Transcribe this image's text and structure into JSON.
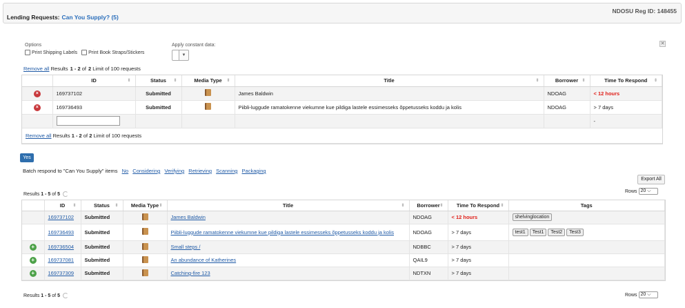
{
  "header": {
    "title": "Lending Requests:",
    "subtitle": "Can You Supply? (5)",
    "reg": "NDOSU Reg ID: 148455"
  },
  "options": {
    "label": "Options",
    "print_shipping": "Print Shipping Labels",
    "print_book": "Print Book Straps/Stickers",
    "apply_label": "Apply constant data:",
    "dropdown_arrow": "▼"
  },
  "close_glyph": "✕",
  "toolbar": {
    "remove_all": "Remove all",
    "results_prefix": "Results",
    "range": "1 - 2",
    "of": "of",
    "total": "2",
    "limit": "Limit of 100 requests"
  },
  "grid1": {
    "columns": [
      "ID",
      "Status",
      "Media Type",
      "Title",
      "Borrower",
      "Time To Respond"
    ],
    "rows": [
      {
        "id": "169737102",
        "status": "Submitted",
        "title": "James Baldwin",
        "borrower": "NDOAG",
        "time": "< 12 hours"
      },
      {
        "id": "169736493",
        "status": "Submitted",
        "title": "Piibli-luggude ramatokenne viekumne kue pildiga lastele essimesseks õppetusseks koddu ja kolis",
        "borrower": "NDOAG",
        "time": "> 7 days"
      }
    ],
    "dash": "-"
  },
  "batch": {
    "yes": "Yes",
    "text": "Batch respond to \"Can You Supply\" items",
    "links": [
      "No",
      "Considering",
      "Verifying",
      "Retrieving",
      "Scanning",
      "Packaging"
    ]
  },
  "export": "Export All",
  "rows_label": "Rows",
  "rows_value": "20",
  "results2": {
    "prefix": "Results",
    "range": "1 - 5",
    "of": "of",
    "total": "5"
  },
  "grid2": {
    "columns": [
      "ID",
      "Status",
      "Media Type",
      "Title",
      "Borrower",
      "Time To Respond",
      "Tags"
    ],
    "rows": [
      {
        "id": "169737102",
        "status": "Submitted",
        "title": "James Baldwin",
        "borrower": "NDOAG",
        "time": "< 12 hours",
        "tags": [
          "shelvinglocation"
        ]
      },
      {
        "id": "169736493",
        "status": "Submitted",
        "title": "Piibli-luggude ramatokenne viekumne kue pildiga lastele essimesseks õppetusseks koddu ja kolis",
        "borrower": "NDOAG",
        "time": "> 7 days",
        "tags": [
          "test1",
          "Test1",
          "Test2",
          "Test3"
        ]
      },
      {
        "id": "169736504",
        "status": "Submitted",
        "title": "Small steps /",
        "borrower": "NDBBC",
        "time": "> 7 days",
        "tags": []
      },
      {
        "id": "169737081",
        "status": "Submitted",
        "title": "An abundance of Katherines",
        "borrower": "QAIL9",
        "time": "> 7 days",
        "tags": []
      },
      {
        "id": "169737309",
        "status": "Submitted",
        "title": "Catching-fire 123",
        "borrower": "NDTXN",
        "time": "> 7 days",
        "tags": []
      }
    ]
  },
  "colors": {
    "accent": "#2e6ead",
    "urgent": "#e0201a",
    "remove": "#c8383c",
    "add": "#4ea24a"
  }
}
